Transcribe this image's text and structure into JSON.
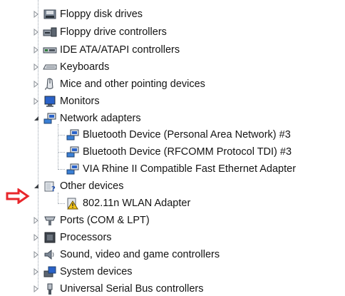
{
  "tree": {
    "categories": [
      {
        "label": "Floppy disk drives",
        "expanded": false,
        "icon": "floppy-disk-icon"
      },
      {
        "label": "Floppy drive controllers",
        "expanded": false,
        "icon": "floppy-controller-icon"
      },
      {
        "label": "IDE ATA/ATAPI controllers",
        "expanded": false,
        "icon": "ide-controller-icon"
      },
      {
        "label": "Keyboards",
        "expanded": false,
        "icon": "keyboard-icon"
      },
      {
        "label": "Mice and other pointing devices",
        "expanded": false,
        "icon": "mouse-icon"
      },
      {
        "label": "Monitors",
        "expanded": false,
        "icon": "monitor-icon"
      },
      {
        "label": "Network adapters",
        "expanded": true,
        "icon": "network-adapter-icon",
        "children": [
          {
            "label": "Bluetooth Device (Personal Area Network) #3",
            "icon": "network-adapter-icon"
          },
          {
            "label": "Bluetooth Device (RFCOMM Protocol TDI) #3",
            "icon": "network-adapter-icon"
          },
          {
            "label": "VIA Rhine II Compatible Fast Ethernet Adapter",
            "icon": "network-adapter-icon"
          }
        ]
      },
      {
        "label": "Other devices",
        "expanded": true,
        "icon": "unknown-device-icon",
        "children": [
          {
            "label": "802.11n WLAN Adapter",
            "icon": "warning-device-icon"
          }
        ]
      },
      {
        "label": "Ports (COM & LPT)",
        "expanded": false,
        "icon": "port-icon"
      },
      {
        "label": "Processors",
        "expanded": false,
        "icon": "processor-icon"
      },
      {
        "label": "Sound, video and game controllers",
        "expanded": false,
        "icon": "speaker-icon"
      },
      {
        "label": "System devices",
        "expanded": false,
        "icon": "system-device-icon"
      },
      {
        "label": "Universal Serial Bus controllers",
        "expanded": false,
        "icon": "usb-icon"
      }
    ]
  },
  "annotation": {
    "arrow_color": "#e8262b",
    "icon": "red-arrow-icon"
  }
}
